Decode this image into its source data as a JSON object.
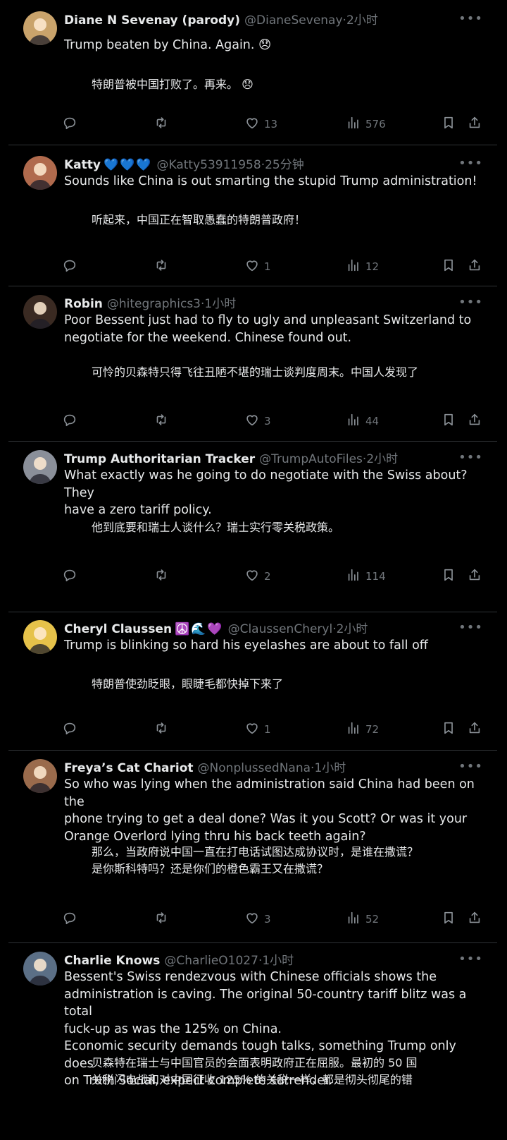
{
  "tweets": [
    {
      "name": "Diane N Sevenay (parody)",
      "badges": "",
      "handle": "@DianeSevenay",
      "time": "2小时",
      "text_en": "Trump beaten by China. Again. 😞",
      "text_zh": "特朗普被中国打败了。再来。 😞",
      "reply": "",
      "retweet": "",
      "likes": "13",
      "views": "576",
      "avatar_color": "#c9a36b"
    },
    {
      "name": "Katty",
      "badges": "💙💙💙",
      "handle": "@Katty53911958",
      "time": "25分钟",
      "text_en": "Sounds like China is out smarting the  stupid Trump administration!",
      "text_zh": "听起来，中国正在智取愚蠢的特朗普政府！",
      "reply": "",
      "retweet": "",
      "likes": "1",
      "views": "12",
      "avatar_color": "#b06a4d"
    },
    {
      "name": "Robin",
      "badges": "",
      "handle": "@hitegraphics3",
      "time": "1小时",
      "text_en": "Poor Bessent just had to fly to ugly and unpleasant Switzerland to\nnegotiate for the weekend. Chinese found out.",
      "text_zh": "可怜的贝森特只得飞往丑陋不堪的瑞士谈判度周末。中国人发现了",
      "reply": "",
      "retweet": "",
      "likes": "3",
      "views": "44",
      "avatar_color": "#3a2a22"
    },
    {
      "name": "Trump Authoritarian Tracker",
      "badges": "",
      "handle": "@TrumpAutoFiles",
      "time": "2小时",
      "text_en": "What exactly was he going to do negotiate with the Swiss about? They\nhave a zero tariff policy.",
      "text_zh": "他到底要和瑞士人谈什么？瑞士实行零关税政策。",
      "reply": "",
      "retweet": "",
      "likes": "2",
      "views": "114",
      "avatar_color": "#8a8f99"
    },
    {
      "name": "Cheryl Claussen",
      "badges": "☮️🌊💜",
      "handle": "@ClaussenCheryl",
      "time": "2小时",
      "text_en": "Trump is blinking so hard his eyelashes are about to fall off",
      "text_zh": "特朗普使劲眨眼，眼睫毛都快掉下来了",
      "reply": "",
      "retweet": "",
      "likes": "1",
      "views": "72",
      "avatar_color": "#e6c24a"
    },
    {
      "name": "Freya’s Cat Chariot",
      "badges": "",
      "handle": "@NonplussedNana",
      "time": "1小时",
      "text_en": "So who was lying when the administration said China had been on the\nphone trying to get a deal done? Was it you Scott? Or was it your\nOrange Overlord lying thru his back teeth again?",
      "text_zh": "那么，当政府说中国一直在打电话试图达成协议时，是谁在撒谎？\n是你斯科特吗？还是你们的橙色霸王又在撒谎？",
      "reply": "",
      "retweet": "",
      "likes": "3",
      "views": "52",
      "avatar_color": "#9a6b4c"
    },
    {
      "name": "Charlie Knows",
      "badges": "",
      "handle": "@CharlieO1027",
      "time": "1小时",
      "text_en": "Bessent's Swiss rendezvous with Chinese officials shows the\nadministration is caving. The original 50-country tariff blitz was a total\nfuck-up as was the 125% on China.\nEconomic security demands tough talks, something Trump only does\non Truth Social, expect complete surrender.",
      "text_zh": "贝森特在瑞士与中国官员的会面表明政府正在屈服。最初的 50 国\n关税闪电战和对中国征收 125% 的关税一样，都是彻头彻尾的错",
      "reply": "",
      "retweet": "",
      "likes": "",
      "views": "",
      "avatar_color": "#5b6f86"
    }
  ],
  "more_label": "•••",
  "dot": "·"
}
